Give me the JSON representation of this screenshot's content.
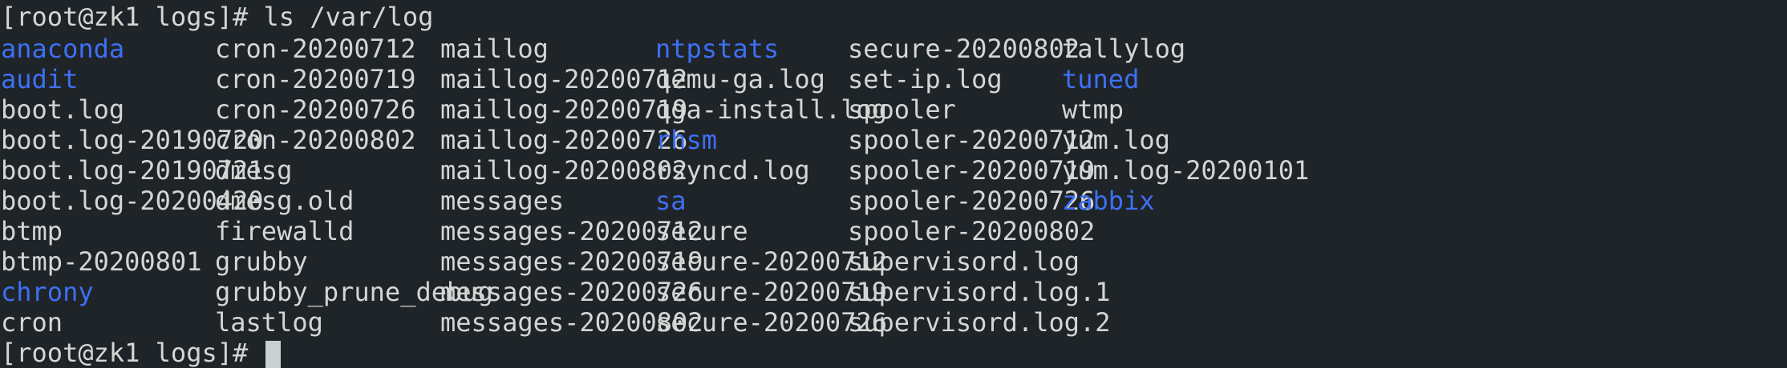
{
  "terminal": {
    "command_line": "[root@zk1 logs]# ls /var/log",
    "prompt": "[root@zk1 logs]#",
    "dir_color": "#3f6ff5",
    "file_color": "#d3d7d4",
    "background_color": "#1e2428",
    "columns": [
      [
        {
          "name": "anaconda",
          "dir": true
        },
        {
          "name": "audit",
          "dir": true
        },
        {
          "name": "boot.log",
          "dir": false
        },
        {
          "name": "boot.log-20190720",
          "dir": false
        },
        {
          "name": "boot.log-20190721",
          "dir": false
        },
        {
          "name": "boot.log-20200420",
          "dir": false
        },
        {
          "name": "btmp",
          "dir": false
        },
        {
          "name": "btmp-20200801",
          "dir": false
        },
        {
          "name": "chrony",
          "dir": true
        },
        {
          "name": "cron",
          "dir": false
        }
      ],
      [
        {
          "name": "cron-20200712",
          "dir": false
        },
        {
          "name": "cron-20200719",
          "dir": false
        },
        {
          "name": "cron-20200726",
          "dir": false
        },
        {
          "name": "cron-20200802",
          "dir": false
        },
        {
          "name": "dmesg",
          "dir": false
        },
        {
          "name": "dmesg.old",
          "dir": false
        },
        {
          "name": "firewalld",
          "dir": false
        },
        {
          "name": "grubby",
          "dir": false
        },
        {
          "name": "grubby_prune_debug",
          "dir": false
        },
        {
          "name": "lastlog",
          "dir": false
        }
      ],
      [
        {
          "name": "maillog",
          "dir": false
        },
        {
          "name": "maillog-20200712",
          "dir": false
        },
        {
          "name": "maillog-20200719",
          "dir": false
        },
        {
          "name": "maillog-20200726",
          "dir": false
        },
        {
          "name": "maillog-20200802",
          "dir": false
        },
        {
          "name": "messages",
          "dir": false
        },
        {
          "name": "messages-20200712",
          "dir": false
        },
        {
          "name": "messages-20200719",
          "dir": false
        },
        {
          "name": "messages-20200726",
          "dir": false
        },
        {
          "name": "messages-20200802",
          "dir": false
        }
      ],
      [
        {
          "name": "ntpstats",
          "dir": true
        },
        {
          "name": "qemu-ga.log",
          "dir": false
        },
        {
          "name": "qga-install.log",
          "dir": false
        },
        {
          "name": "rhsm",
          "dir": true
        },
        {
          "name": "rsyncd.log",
          "dir": false
        },
        {
          "name": "sa",
          "dir": true
        },
        {
          "name": "secure",
          "dir": false
        },
        {
          "name": "secure-20200712",
          "dir": false
        },
        {
          "name": "secure-20200719",
          "dir": false
        },
        {
          "name": "secure-20200726",
          "dir": false
        }
      ],
      [
        {
          "name": "secure-20200802",
          "dir": false
        },
        {
          "name": "set-ip.log",
          "dir": false
        },
        {
          "name": "spooler",
          "dir": false
        },
        {
          "name": "spooler-20200712",
          "dir": false
        },
        {
          "name": "spooler-20200719",
          "dir": false
        },
        {
          "name": "spooler-20200726",
          "dir": false
        },
        {
          "name": "spooler-20200802",
          "dir": false
        },
        {
          "name": "supervisord.log",
          "dir": false
        },
        {
          "name": "supervisord.log.1",
          "dir": false
        },
        {
          "name": "supervisord.log.2",
          "dir": false
        }
      ],
      [
        {
          "name": "tallylog",
          "dir": false
        },
        {
          "name": "tuned",
          "dir": true
        },
        {
          "name": "wtmp",
          "dir": false
        },
        {
          "name": "yum.log",
          "dir": false
        },
        {
          "name": "yum.log-20200101",
          "dir": false
        },
        {
          "name": "zabbix",
          "dir": true
        }
      ]
    ]
  }
}
